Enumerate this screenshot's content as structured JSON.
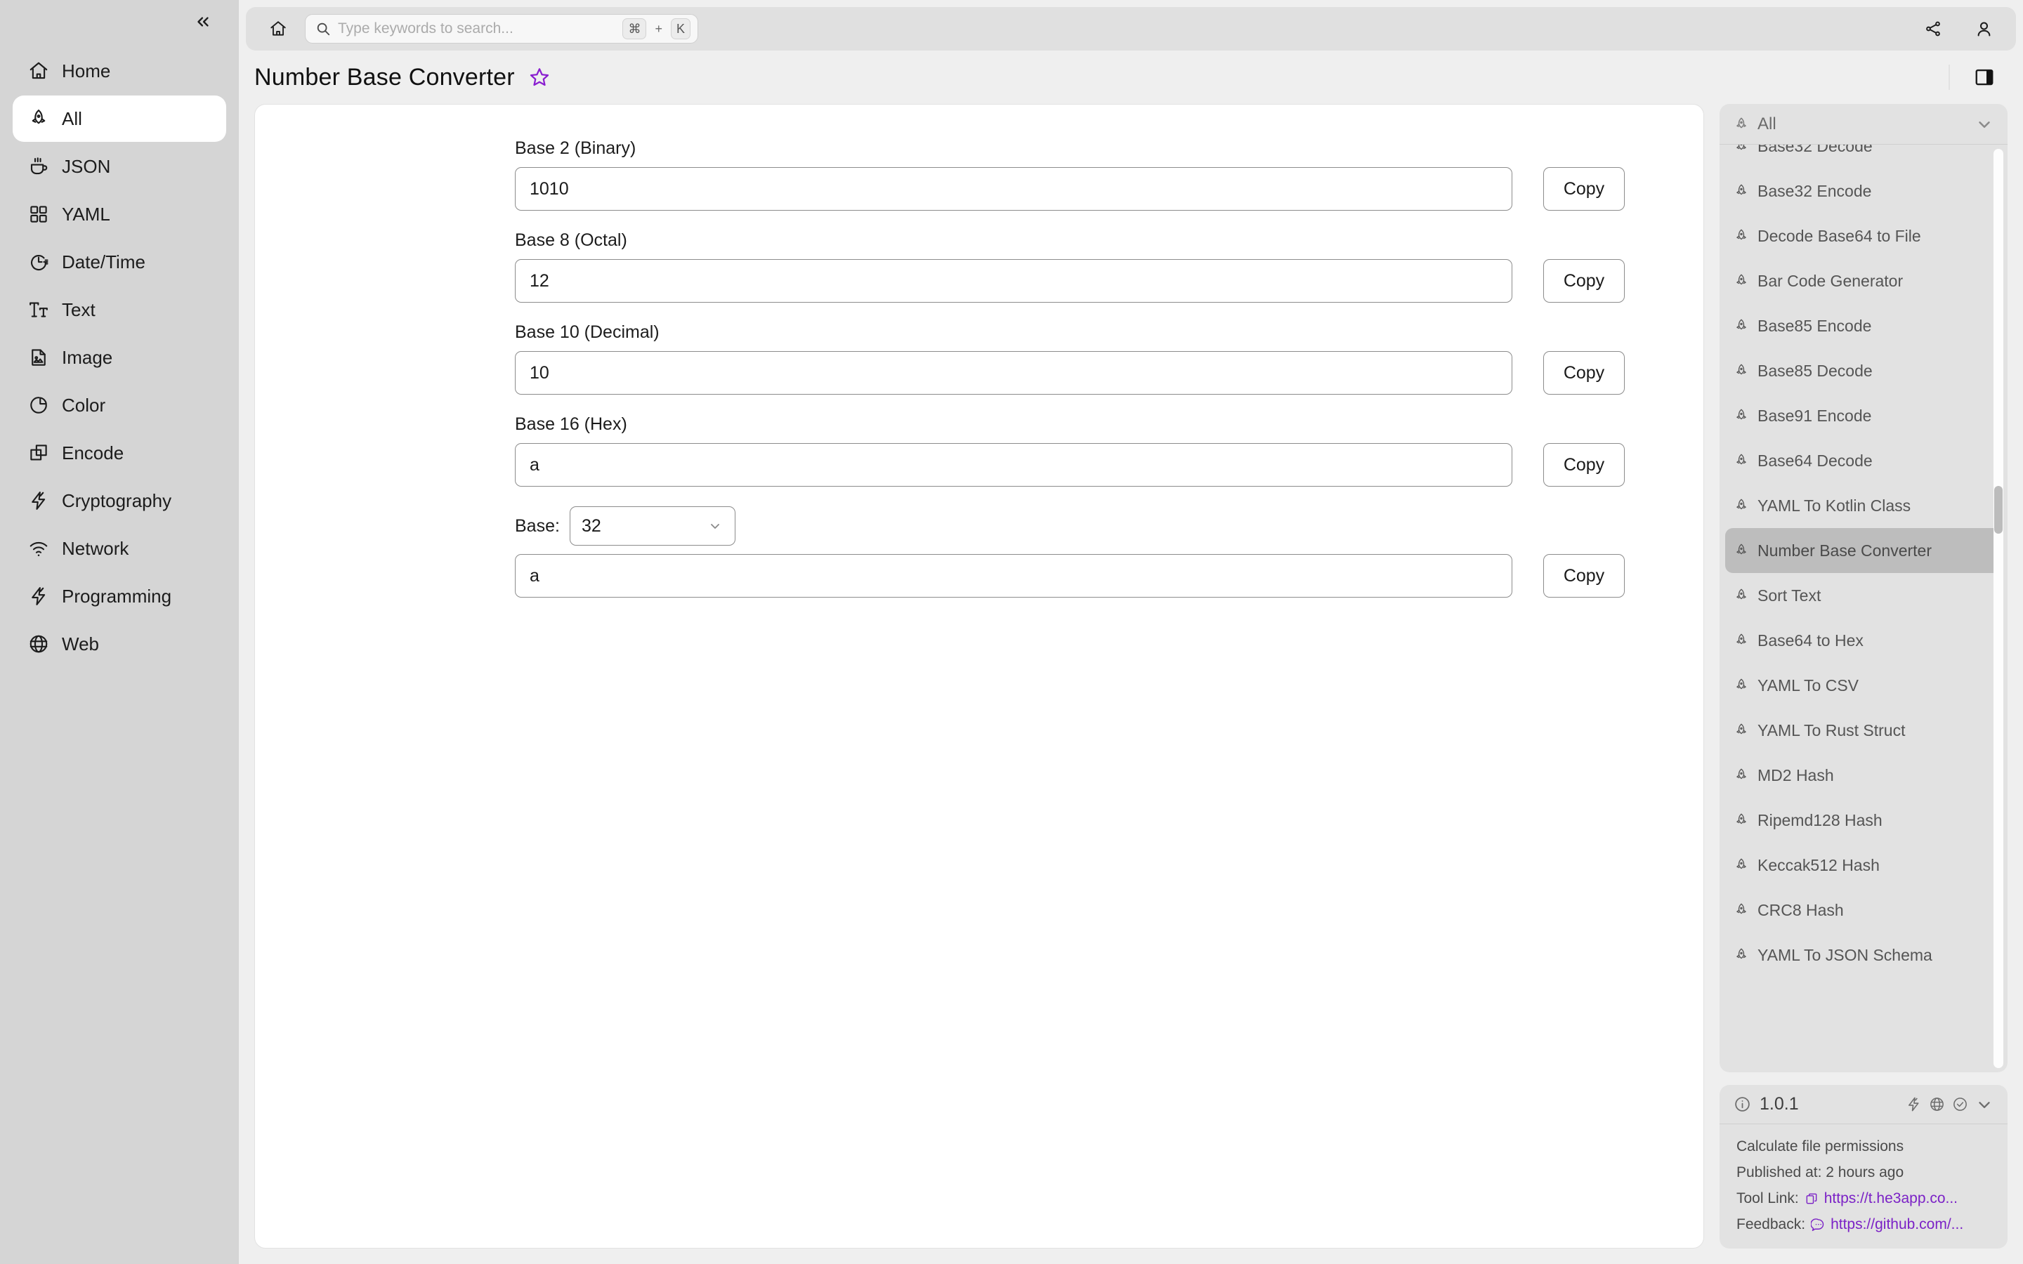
{
  "sidebar": {
    "collapse_icon": "chevrons-left-icon",
    "items": [
      {
        "label": "Home",
        "icon": "house-icon",
        "active": false
      },
      {
        "label": "All",
        "icon": "rocket-icon",
        "active": true
      },
      {
        "label": "JSON",
        "icon": "coffee-cup-icon",
        "active": false
      },
      {
        "label": "YAML",
        "icon": "grid-icon",
        "active": false
      },
      {
        "label": "Date/Time",
        "icon": "clock-icon",
        "active": false
      },
      {
        "label": "Text",
        "icon": "text-size-icon",
        "active": false
      },
      {
        "label": "Image",
        "icon": "image-file-icon",
        "active": false
      },
      {
        "label": "Color",
        "icon": "pie-chart-icon",
        "active": false
      },
      {
        "label": "Encode",
        "icon": "copy-layers-icon",
        "active": false
      },
      {
        "label": "Cryptography",
        "icon": "lightning-icon",
        "active": false
      },
      {
        "label": "Network",
        "icon": "wifi-icon",
        "active": false
      },
      {
        "label": "Programming",
        "icon": "lightning-icon",
        "active": false
      },
      {
        "label": "Web",
        "icon": "globe-icon",
        "active": false
      }
    ]
  },
  "topbar": {
    "home_icon": "house-icon",
    "search": {
      "icon": "search-icon",
      "placeholder": "Type keywords to search...",
      "value": "",
      "key_cmd": "⌘",
      "key_plus": "+",
      "key_letter": "K"
    },
    "share_icon": "share-icon",
    "account_icon": "user-icon"
  },
  "header": {
    "title": "Number Base Converter",
    "favorite_icon": "star-outline-icon",
    "favorite_color": "#8a1fd0",
    "panel_toggle_icon": "panel-right-icon"
  },
  "main": {
    "fields": [
      {
        "label": "Base 2 (Binary)",
        "value": "1010",
        "copy_label": "Copy"
      },
      {
        "label": "Base 8 (Octal)",
        "value": "12",
        "copy_label": "Copy"
      },
      {
        "label": "Base 10 (Decimal)",
        "value": "10",
        "copy_label": "Copy"
      },
      {
        "label": "Base 16 (Hex)",
        "value": "a",
        "copy_label": "Copy"
      }
    ],
    "custom_base": {
      "label": "Base:",
      "selected": "32",
      "chevron_icon": "chevron-down-icon",
      "value": "a",
      "copy_label": "Copy"
    }
  },
  "tools_panel": {
    "header": {
      "icon": "rocket-icon",
      "label": "All",
      "chevron_icon": "chevron-down-icon"
    },
    "items": [
      {
        "label": "Base32 Decode",
        "selected": false
      },
      {
        "label": "Base32 Encode",
        "selected": false
      },
      {
        "label": "Decode Base64 to File",
        "selected": false
      },
      {
        "label": "Bar Code Generator",
        "selected": false
      },
      {
        "label": "Base85 Encode",
        "selected": false
      },
      {
        "label": "Base85 Decode",
        "selected": false
      },
      {
        "label": "Base91 Encode",
        "selected": false
      },
      {
        "label": "Base64 Decode",
        "selected": false
      },
      {
        "label": "YAML To Kotlin Class",
        "selected": false
      },
      {
        "label": "Number Base Converter",
        "selected": true
      },
      {
        "label": "Sort Text",
        "selected": false
      },
      {
        "label": "Base64 to Hex",
        "selected": false
      },
      {
        "label": "YAML To CSV",
        "selected": false
      },
      {
        "label": "YAML To Rust Struct",
        "selected": false
      },
      {
        "label": "MD2 Hash",
        "selected": false
      },
      {
        "label": "Ripemd128 Hash",
        "selected": false
      },
      {
        "label": "Keccak512 Hash",
        "selected": false
      },
      {
        "label": "CRC8 Hash",
        "selected": false
      },
      {
        "label": "YAML To JSON Schema",
        "selected": false
      }
    ]
  },
  "info_panel": {
    "info_icon": "info-circle-icon",
    "version": "1.0.1",
    "head_icons": [
      "lightning-icon",
      "globe-icon",
      "check-circle-icon",
      "chevron-down-icon"
    ],
    "description": "Calculate file permissions",
    "published": "Published at: 2 hours ago",
    "tool_link_label": "Tool Link:",
    "tool_link_icon": "copy-icon",
    "tool_link_url": "https://t.he3app.co...",
    "feedback_label": "Feedback:",
    "feedback_icon": "message-icon",
    "feedback_url": "https://github.com/...",
    "link_color": "#7b22c6"
  }
}
